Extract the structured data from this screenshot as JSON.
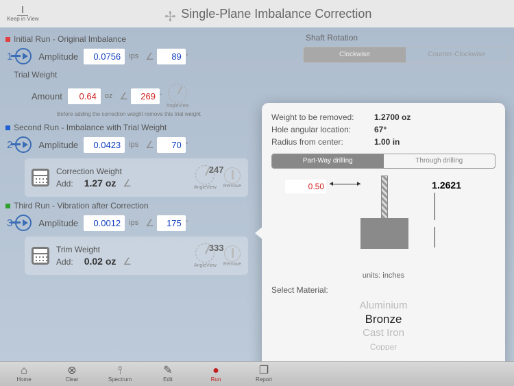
{
  "header": {
    "keepInView": "Keep in View",
    "title": "Single-Plane Imbalance Correction"
  },
  "shaftRotation": {
    "label": "Shaft Rotation",
    "cw": "Clockwise",
    "ccw": "Counter-Clockwise"
  },
  "run1": {
    "title": "Initial Run - Original Imbalance",
    "num": "1",
    "ampLabel": "Amplitude",
    "amp": "0.0756",
    "unit": "ips",
    "angle": "89"
  },
  "trial": {
    "title": "Trial Weight",
    "amtLabel": "Amount",
    "amt": "0.64",
    "unit": "oz",
    "angle": "269",
    "note": "Before adding the correction weight remove this trial weight",
    "angleView": "AngleView"
  },
  "run2": {
    "title": "Second Run - Imbalance with Trial Weight",
    "num": "2",
    "ampLabel": "Amplitude",
    "amp": "0.0423",
    "unit": "ips",
    "angle": "70"
  },
  "correction": {
    "title": "Correction Weight",
    "addLabel": "Add:",
    "val": "1.27 oz",
    "angle": "247",
    "angleView": "AngleView",
    "remove": "Remove"
  },
  "run3": {
    "title": "Third Run - Vibration after Correction",
    "num": "3",
    "ampLabel": "Amplitude",
    "amp": "0.0012",
    "unit": "ips",
    "angle": "175"
  },
  "trim": {
    "title": "Trim Weight",
    "addLabel": "Add:",
    "val": "0.02 oz",
    "angle": "333",
    "angleView": "AngleView",
    "remove": "Remove"
  },
  "popup": {
    "weightLabel": "Weight to be removed:",
    "weightVal": "1.2700 oz",
    "holeLabel": "Hole angular location:",
    "holeVal": "67°",
    "radiusLabel": "Radius from center:",
    "radiusVal": "1.00 in",
    "partWay": "Part-Way drilling",
    "through": "Through drilling",
    "diameter": "0.50",
    "depth": "1.2621",
    "units": "units: inches",
    "selectMaterial": "Select Material:",
    "materials": {
      "m0": "Aluminium",
      "m1": "Bronze",
      "m2": "Cast Iron",
      "m3": "Copper"
    }
  },
  "toolbar": {
    "home": "Home",
    "clear": "Clear",
    "spectrum": "Spectrum",
    "edit": "Edit",
    "run": "Run",
    "report": "Report"
  }
}
